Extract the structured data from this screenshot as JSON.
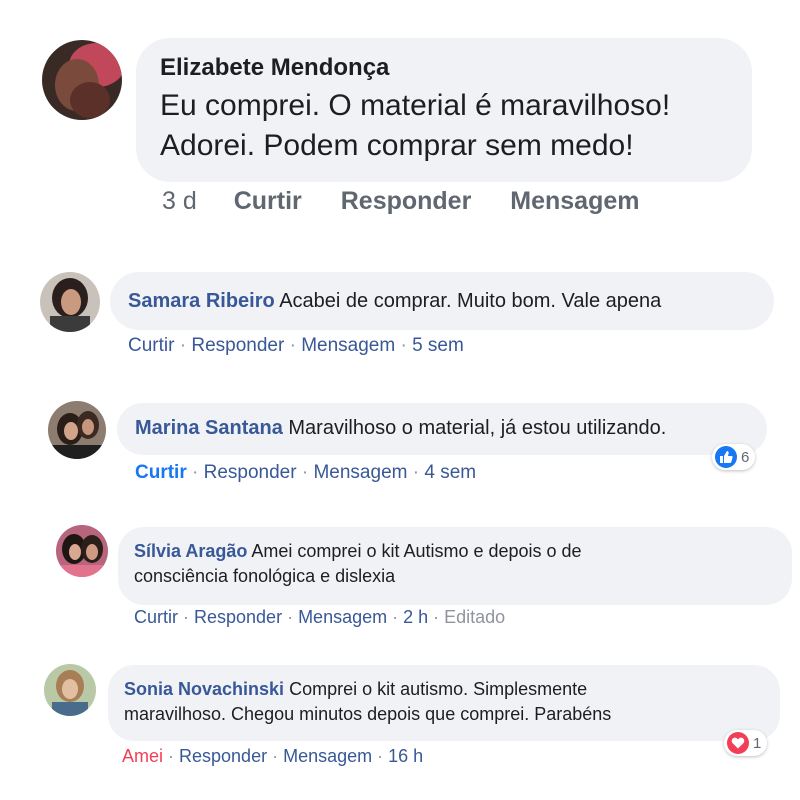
{
  "colors": {
    "link": "#385898",
    "bubble_bg": "#f0f2f5",
    "meta": "#90949c",
    "love": "#f33e58",
    "like": "#1877f2"
  },
  "comments": [
    {
      "author": "Elizabete Mendonça",
      "text": "Eu comprei.  O material é maravilhoso! Adorei.  Podem comprar sem medo!",
      "text_line1": "Eu comprei.  O material é maravilhoso!",
      "text_line2": "Adorei.  Podem comprar sem medo!",
      "time": "3 d",
      "like_label": "Curtir",
      "reply_label": "Responder",
      "message_label": "Mensagem"
    },
    {
      "author": "Samara Ribeiro",
      "text": "Acabei de comprar. Muito bom. Vale apena",
      "like_label": "Curtir",
      "reply_label": "Responder",
      "message_label": "Mensagem",
      "time": "5 sem"
    },
    {
      "author": "Marina Santana",
      "text": "Maravilhoso o material, já estou utilizando.",
      "like_label": "Curtir",
      "reply_label": "Responder",
      "message_label": "Mensagem",
      "time": "4 sem",
      "reaction": {
        "icon": "like-icon",
        "count": "6"
      }
    },
    {
      "author": "Sílvia Aragão",
      "text_line1": "Amei comprei o kit Autismo e depois o de",
      "text_line2": "consciência fonológica e dislexia",
      "like_label": "Curtir",
      "reply_label": "Responder",
      "message_label": "Mensagem",
      "time": "2 h",
      "edited": "Editado"
    },
    {
      "author": "Sonia Novachinski",
      "text_line1": "Comprei o kit autismo. Simplesmente",
      "text_line2": "maravilhoso. Chegou minutos depois que comprei. Parabéns",
      "like_label": "Amei",
      "reply_label": "Responder",
      "message_label": "Mensagem",
      "time": "16 h",
      "reaction": {
        "icon": "love-icon",
        "count": "1"
      }
    }
  ]
}
